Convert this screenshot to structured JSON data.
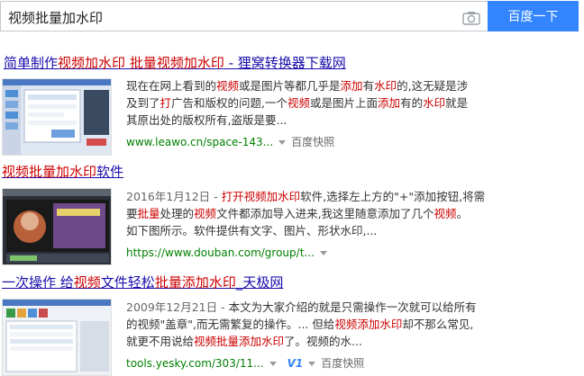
{
  "search": {
    "query": "视频批量加水印",
    "button_label": "百度一下"
  },
  "results": [
    {
      "title": [
        "简单制作",
        "视频加水印",
        " ",
        "批量视频加水印",
        " - 狸窝转换器下载网"
      ],
      "abstract": [
        [
          "现在在网上看到的",
          "视频",
          "或是图片等都几乎是",
          "添加",
          "有",
          "水印",
          "的,这无疑是涉"
        ],
        [
          "及到了",
          "打",
          "广告和版权的问题,一个",
          "视频",
          "或是图片上面",
          "添加",
          "有的",
          "水印",
          "就是"
        ],
        [
          "其原出处的版权所有,盗版是要..."
        ]
      ],
      "url": "www.leawo.cn/space-143...",
      "snapshot": "百度快照"
    },
    {
      "title": [
        "视频批量加水印",
        "软件"
      ],
      "abstract": [
        [
          "2016年1月12日 - ",
          "打开",
          "视频加水印",
          "软件,选择左上方的\"+\"添加按钮,将需"
        ],
        [
          "要",
          "批量",
          "处理的",
          "视频",
          "文件都添加导入进来,我这里随意添加了几个",
          "视频",
          "。"
        ],
        [
          "如下图所示。软件提供有文字、图片、形状水印,..."
        ]
      ],
      "url": "https://www.douban.com/group/t...",
      "snapshot": ""
    },
    {
      "title": [
        "一次操作 给",
        "视频",
        "文件轻松",
        "批量添加水印",
        "_天极网"
      ],
      "abstract": [
        [
          "2009年12月21日 - ",
          "本文为大家介绍的就是只需操作一次就可以给所有"
        ],
        [
          "的视频\"盖章\",而无需繁复的操作。... 但给",
          "视频添加水印",
          "却不那么常见,"
        ],
        [
          "就更不用说给",
          "视频批量添加水印",
          "了。视频的水..."
        ]
      ],
      "url": "tools.yesky.com/303/11...",
      "badge": "V1",
      "snapshot": "百度快照"
    }
  ]
}
